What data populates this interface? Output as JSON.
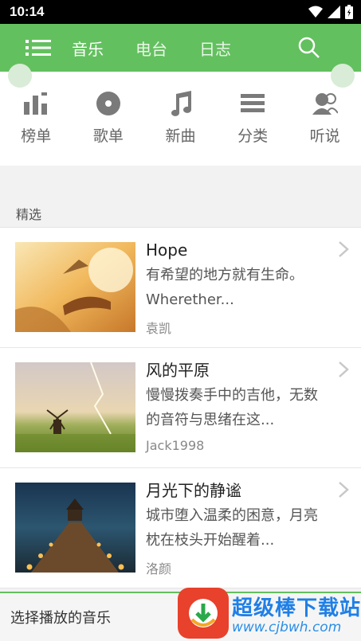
{
  "status_bar": {
    "time": "10:14"
  },
  "nav": {
    "tabs": [
      "音乐",
      "电台",
      "日志"
    ],
    "active_index": 0
  },
  "quick_nav": [
    {
      "label": "榜单",
      "icon": "chart-bars-icon"
    },
    {
      "label": "歌单",
      "icon": "disc-icon"
    },
    {
      "label": "新曲",
      "icon": "music-note-icon"
    },
    {
      "label": "分类",
      "icon": "category-list-icon"
    },
    {
      "label": "听说",
      "icon": "listeners-icon"
    }
  ],
  "section": {
    "title": "精选"
  },
  "items": [
    {
      "title": "Hope",
      "desc_line1": "有希望的地方就有生命。",
      "desc_line2": "Wherether...",
      "author": "袁凯"
    },
    {
      "title": "风的平原",
      "desc_line1": "慢慢拨奏手中的吉他，无数",
      "desc_line2": "的音符与思绪在这...",
      "author": "Jack1998"
    },
    {
      "title": "月光下的静谧",
      "desc_line1": "城市堕入温柔的困意，月亮",
      "desc_line2": "枕在枝头开始醒着...",
      "author": "洛颜"
    }
  ],
  "player": {
    "label": "选择播放的音乐"
  },
  "watermark": {
    "title": "超级棒下载站",
    "url": "www.cjbwh.com"
  },
  "colors": {
    "accent": "#63c05f",
    "icon_gray": "#7a7a7a"
  }
}
